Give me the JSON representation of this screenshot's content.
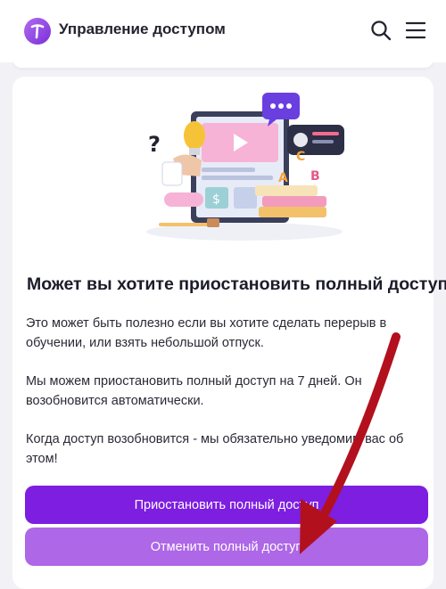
{
  "header": {
    "title": "Управление доступом",
    "logo_icon": "brand-logo-icon",
    "search_icon": "search-icon",
    "menu_icon": "hamburger-menu-icon"
  },
  "dialog": {
    "title": "Может вы хотите приостановить полный доступ?",
    "paragraphs": [
      "Это может быть полезно если вы хотите сделать перерыв в обучении, или взять небольшой отпуск.",
      "Мы можем приостановить полный доступ на 7 дней. Он возобновится автоматически.",
      "Когда доступ возобновится - мы обязательно уведомим вас об этом!"
    ],
    "pause_button": "Приостановить полный доступ",
    "cancel_button": "Отменить полный доступ"
  },
  "colors": {
    "primary": "#7d1ee0",
    "secondary": "#ad67e7",
    "arrow": "#b3101e",
    "background": "#f2f2f6"
  }
}
